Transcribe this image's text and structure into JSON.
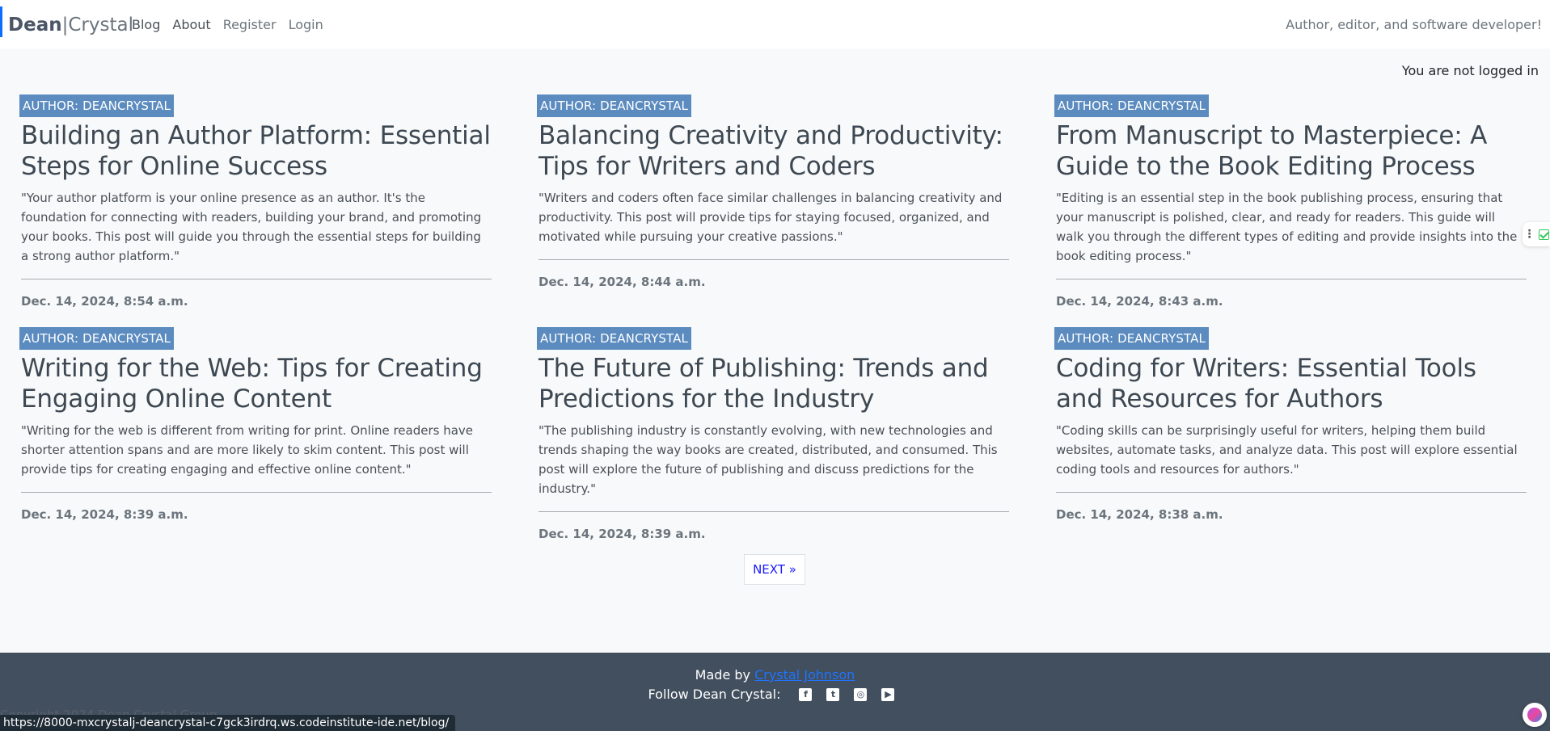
{
  "brand": {
    "part1": "Dean",
    "separator": "|",
    "part2": "Crystal"
  },
  "nav": [
    {
      "label": "Blog",
      "muted": false
    },
    {
      "label": "About",
      "muted": false
    },
    {
      "label": "Register",
      "muted": true
    },
    {
      "label": "Login",
      "muted": true
    }
  ],
  "tagline": "Author, editor, and software developer!",
  "login_status": "You are not logged in",
  "posts": [
    {
      "author": "AUTHOR: DEANCRYSTAL",
      "title": "Building an Author Platform: Essential Steps for Online Success",
      "excerpt": "\"Your author platform is your online presence as an author. It's the foundation for connecting with readers, building your brand, and promoting your books. This post will guide you through the essential steps for building a strong author platform.\"",
      "date": "Dec. 14, 2024, 8:54 a.m."
    },
    {
      "author": "AUTHOR: DEANCRYSTAL",
      "title": "Balancing Creativity and Productivity: Tips for Writers and Coders",
      "excerpt": "\"Writers and coders often face similar challenges in balancing creativity and productivity. This post will provide tips for staying focused, organized, and motivated while pursuing your creative passions.\"",
      "date": "Dec. 14, 2024, 8:44 a.m."
    },
    {
      "author": "AUTHOR: DEANCRYSTAL",
      "title": "From Manuscript to Masterpiece: A Guide to the Book Editing Process",
      "excerpt": "\"Editing is an essential step in the book publishing process, ensuring that your manuscript is polished, clear, and ready for readers. This guide will walk you through the different types of editing and provide insights into the book editing process.\"",
      "date": "Dec. 14, 2024, 8:43 a.m."
    },
    {
      "author": "AUTHOR: DEANCRYSTAL",
      "title": "Writing for the Web: Tips for Creating Engaging Online Content",
      "excerpt": "\"Writing for the web is different from writing for print. Online readers have shorter attention spans and are more likely to skim content. This post will provide tips for creating engaging and effective online content.\"",
      "date": "Dec. 14, 2024, 8:39 a.m."
    },
    {
      "author": "AUTHOR: DEANCRYSTAL",
      "title": "The Future of Publishing: Trends and Predictions for the Industry",
      "excerpt": "\"The publishing industry is constantly evolving, with new technologies and trends shaping the way books are created, distributed, and consumed. This post will explore the future of publishing and discuss predictions for the industry.\"",
      "date": "Dec. 14, 2024, 8:39 a.m."
    },
    {
      "author": "AUTHOR: DEANCRYSTAL",
      "title": "Coding for Writers: Essential Tools and Resources for Authors",
      "excerpt": "\"Coding skills can be surprisingly useful for writers, helping them build websites, automate tasks, and analyze data. This post will explore essential coding tools and resources for authors.\"",
      "date": "Dec. 14, 2024, 8:38 a.m."
    }
  ],
  "pagination": {
    "next_label": "NEXT »"
  },
  "footer": {
    "made_by_prefix": "Made by",
    "made_by_link": "Crystal Johnson",
    "follow_label": "Follow Dean Crystal:",
    "social_icons": [
      "facebook-icon",
      "twitter-icon",
      "instagram-icon",
      "youtube-icon"
    ],
    "copyright": "Copyright 2024 Dean Crystal Group"
  },
  "status_bar_url": "https://8000-mxcrystalj-deancrystal-c7gck3irdrq.ws.codeinstitute-ide.net/blog/",
  "colors": {
    "accent": "#0d6efd",
    "badge": "#5b8bbf",
    "footer_bg": "#424f5e"
  }
}
